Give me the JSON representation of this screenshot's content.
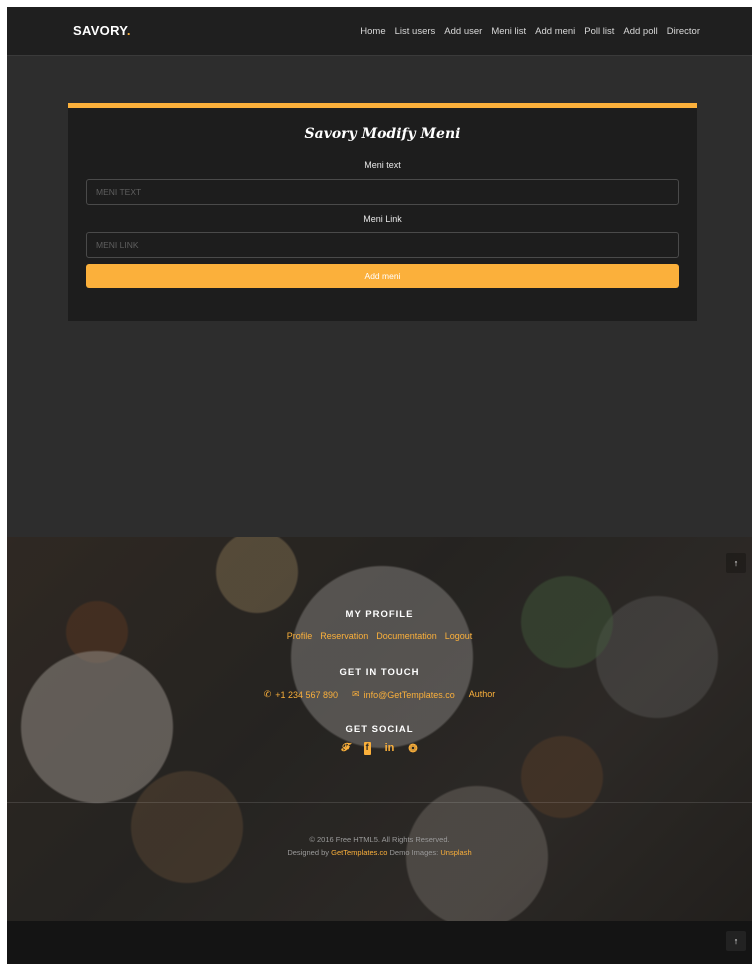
{
  "header": {
    "brand": "SAVORY",
    "brand_dot": ".",
    "nav": [
      "Home",
      "List users",
      "Add user",
      "Meni list",
      "Add meni",
      "Poll list",
      "Add poll",
      "Director"
    ]
  },
  "form": {
    "title": "Savory Modify Meni",
    "text_label": "Meni text",
    "text_placeholder": "MENI TEXT",
    "link_label": "Meni Link",
    "link_placeholder": "MENI LINK",
    "submit_label": "Add meni"
  },
  "footer": {
    "profile_heading": "MY PROFILE",
    "profile_links": [
      "Profile",
      "Reservation",
      "Documentation",
      "Logout"
    ],
    "touch_heading": "GET IN TOUCH",
    "phone": "+1 234 567 890",
    "email": "info@GetTemplates.co",
    "author": "Author",
    "social_heading": "GET SOCIAL",
    "copyright": "© 2016 Free HTML5. All Rights Reserved.",
    "designed_prefix": "Designed by",
    "designed_link": "GetTemplates.co",
    "demo_images": "Demo Images:",
    "demo_link": "Unsplash"
  },
  "icons": {
    "phone": "phone-icon",
    "email": "envelope-icon",
    "social": [
      "twitter-icon",
      "facebook-icon",
      "linkedin-icon",
      "dribbble-icon"
    ],
    "back_to_top": "arrow-up-icon"
  },
  "colors": {
    "accent": "#fbb03b",
    "background": "#2d2d2d",
    "card": "#1d1d1d"
  }
}
